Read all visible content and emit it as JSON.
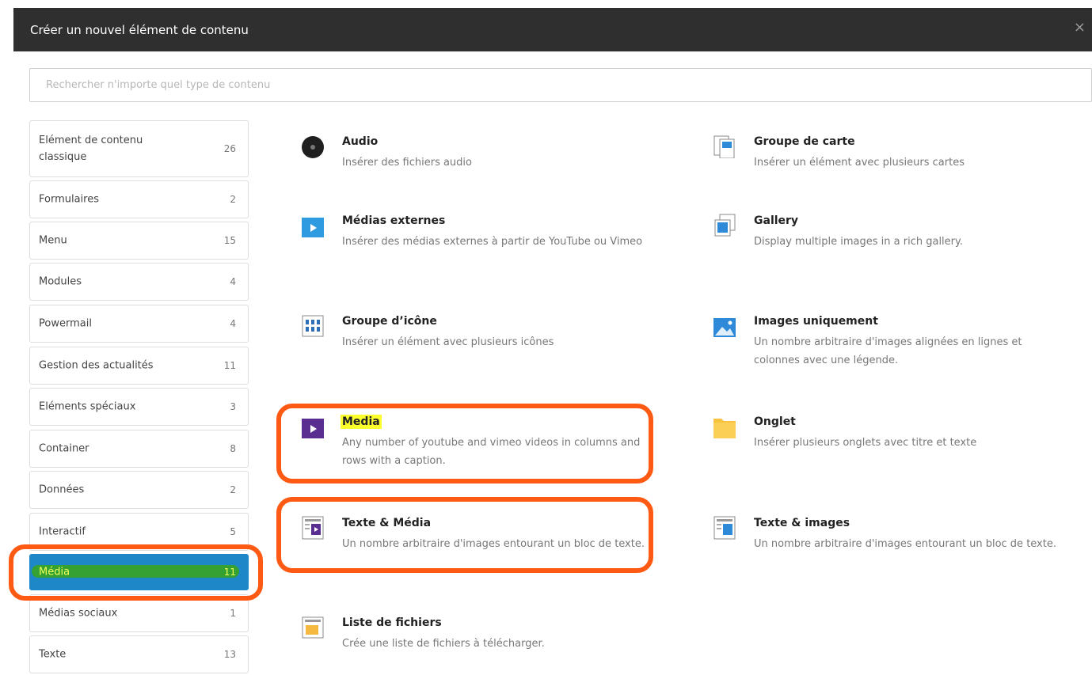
{
  "dialog": {
    "title": "Créer un nouvel élément de contenu",
    "close": "×"
  },
  "search": {
    "placeholder": "Rechercher n'importe quel type de contenu",
    "value": ""
  },
  "categories": [
    {
      "label": "Elément de contenu classique",
      "count": "26"
    },
    {
      "label": "Formulaires",
      "count": "2"
    },
    {
      "label": "Menu",
      "count": "15"
    },
    {
      "label": "Modules",
      "count": "4"
    },
    {
      "label": "Powermail",
      "count": "4"
    },
    {
      "label": "Gestion des actualités",
      "count": "11"
    },
    {
      "label": "Eléments spéciaux",
      "count": "3"
    },
    {
      "label": "Container",
      "count": "8"
    },
    {
      "label": "Données",
      "count": "2"
    },
    {
      "label": "Interactif",
      "count": "5"
    },
    {
      "label": "Média",
      "count": "11",
      "active": true
    },
    {
      "label": "Médias sociaux",
      "count": "1"
    },
    {
      "label": "Texte",
      "count": "13"
    }
  ],
  "items": [
    {
      "icon": "audio-disc-icon",
      "name": "Audio",
      "desc": "Insérer des fichiers audio"
    },
    {
      "icon": "card-group-icon",
      "name": "Groupe de carte",
      "desc": "Insérer un élément avec plusieurs cartes"
    },
    {
      "icon": "external-media-play-icon",
      "name": "Médias externes",
      "desc": "Insérer des médias externes à partir de YouTube ou Vimeo"
    },
    {
      "icon": "gallery-icon",
      "name": "Gallery",
      "desc": "Display multiple images in a rich gallery."
    },
    {
      "icon": "icon-group-grid-icon",
      "name": "Groupe d’icône",
      "desc": "Insérer un élément avec plusieurs icônes"
    },
    {
      "icon": "image-landscape-icon",
      "name": "Images uniquement",
      "desc": "Un nombre arbitraire d'images alignées en lignes et colonnes avec une légende."
    },
    {
      "icon": "media-play-icon",
      "name": "Media",
      "desc": "Any number of youtube and vimeo videos in columns and rows with a caption."
    },
    {
      "icon": "tab-folder-icon",
      "name": "Onglet",
      "desc": "Insérer plusieurs onglets avec titre et texte"
    },
    {
      "icon": "text-media-icon",
      "name": "Texte & Média",
      "desc": "Un nombre arbitraire d'images entourant un bloc de texte."
    },
    {
      "icon": "text-images-icon",
      "name": "Texte & images",
      "desc": "Un nombre arbitraire d'images entourant un bloc de texte."
    },
    {
      "icon": "file-list-icon",
      "name": "Liste de fichiers",
      "desc": "Crée une liste de fichiers à télécharger."
    }
  ],
  "colors": {
    "header_bg": "#2f2f2f",
    "active_category": "#1e87c7",
    "annotation_outline": "#ff5a14",
    "highlight": "#fbff2c"
  }
}
